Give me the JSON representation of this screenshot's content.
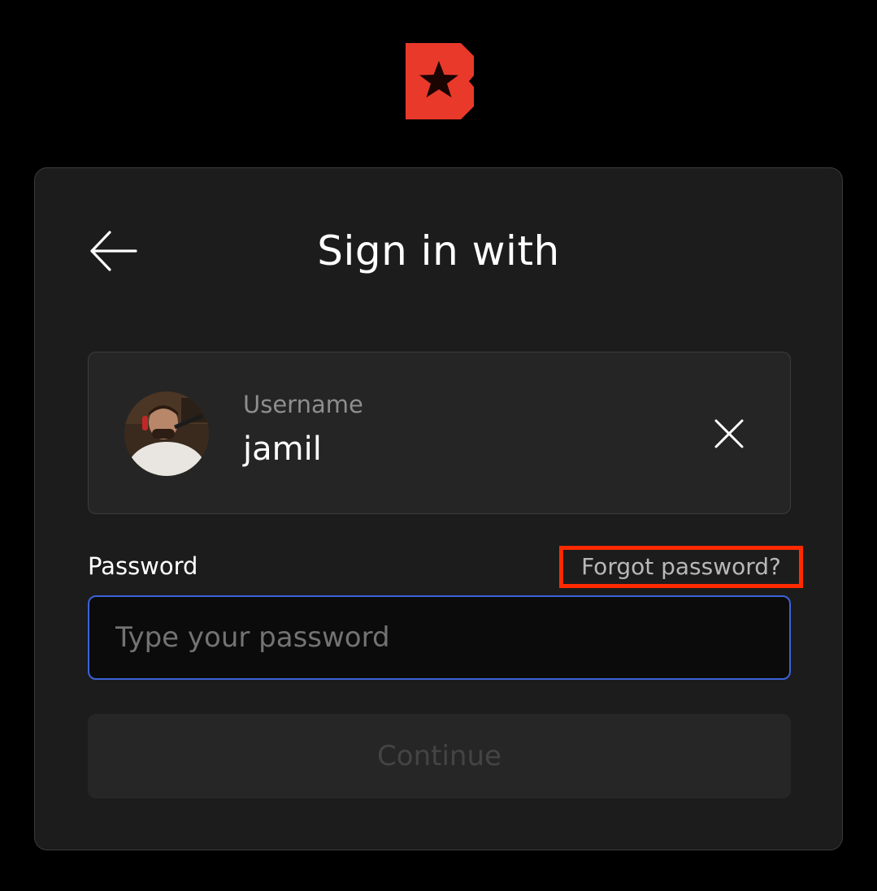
{
  "logo": {
    "icon": "beast-b-star-logo",
    "color": "#e8392a"
  },
  "header": {
    "title": "Sign in with",
    "back_icon": "arrow-left-icon"
  },
  "account": {
    "label": "Username",
    "value": "jamil",
    "avatar_icon": "user-avatar",
    "clear_icon": "close-icon"
  },
  "password": {
    "label": "Password",
    "forgot_link": "Forgot password?",
    "placeholder": "Type your password",
    "value": ""
  },
  "actions": {
    "continue_label": "Continue",
    "continue_enabled": false
  },
  "colors": {
    "background": "#000000",
    "card": "#1c1c1c",
    "accent_focus": "#3b63d9",
    "highlight": "#ff2a00"
  }
}
